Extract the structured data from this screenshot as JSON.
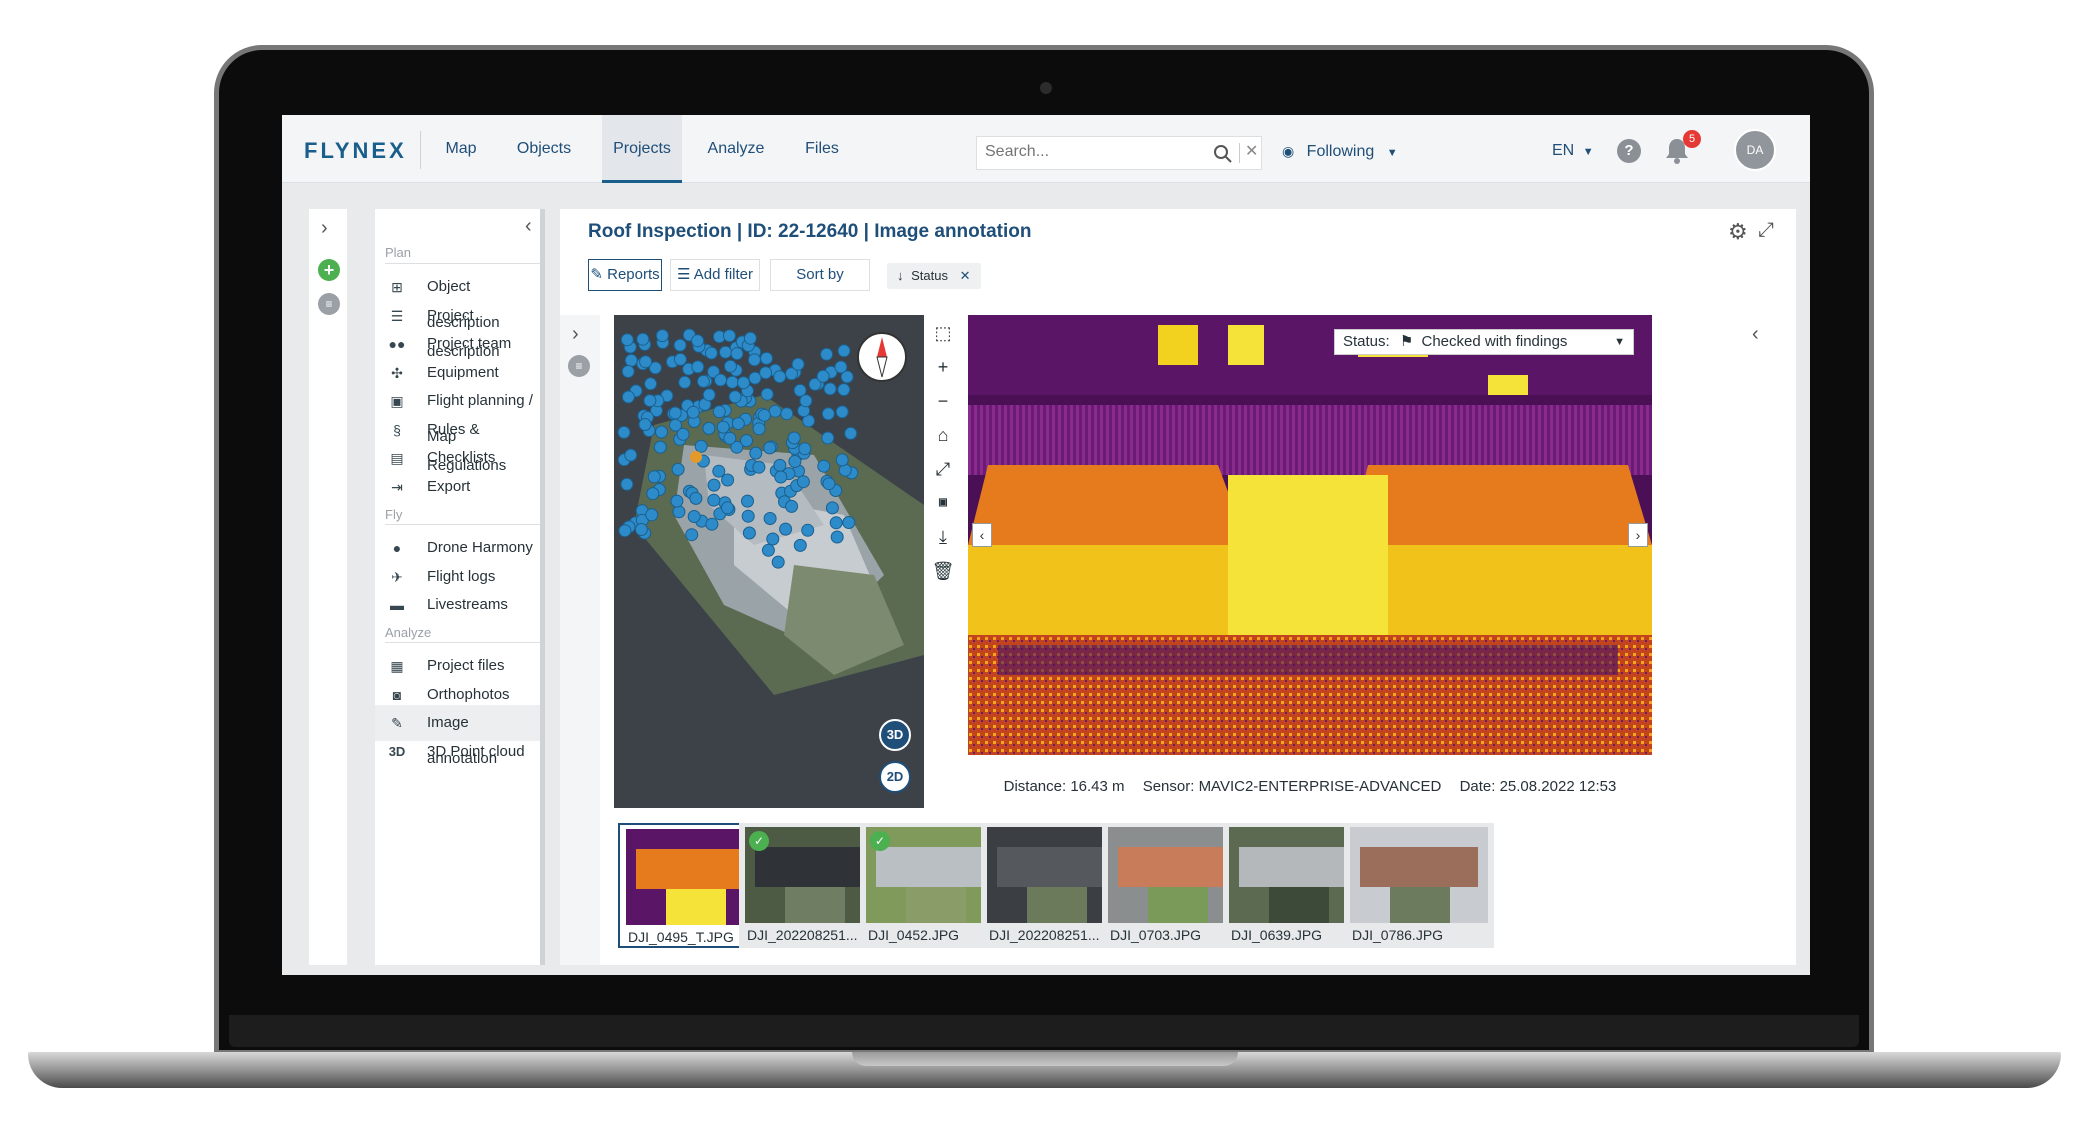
{
  "app": {
    "logo": "FLYNEX"
  },
  "nav": [
    {
      "label": "Map"
    },
    {
      "label": "Objects"
    },
    {
      "label": "Projects"
    },
    {
      "label": "Analyze"
    },
    {
      "label": "Files"
    }
  ],
  "search": {
    "placeholder": "Search..."
  },
  "header": {
    "following": "Following",
    "language": "EN",
    "help": "?",
    "notifications": "5",
    "avatar": "DA"
  },
  "sidebar": {
    "sections": [
      "Plan",
      "Fly",
      "Analyze"
    ],
    "items": [
      {
        "label": "Object description",
        "icon": "object-tree-icon"
      },
      {
        "label": "Project description",
        "icon": "list-icon"
      },
      {
        "label": "Project team",
        "icon": "team-icon"
      },
      {
        "label": "Equipment",
        "icon": "drone-icon"
      },
      {
        "label": "Flight planning / Map",
        "icon": "map-plan-icon"
      },
      {
        "label": "Rules & Regulations",
        "icon": "paragraph-icon"
      },
      {
        "label": "Checklists",
        "icon": "clipboard-icon"
      },
      {
        "label": "Export",
        "icon": "export-icon"
      },
      {
        "label": "Drone Harmony",
        "icon": "circle-icon"
      },
      {
        "label": "Flight logs",
        "icon": "plane-icon"
      },
      {
        "label": "Livestreams",
        "icon": "live-icon"
      },
      {
        "label": "Project files",
        "icon": "files-icon"
      },
      {
        "label": "Orthophotos",
        "icon": "camera-icon"
      },
      {
        "label": "Image annotation",
        "icon": "annotate-icon"
      },
      {
        "label": "3D Point cloud",
        "icon": "3d-icon"
      }
    ],
    "icon_3d": "3D"
  },
  "main": {
    "title": "Roof Inspection | ID: 22-12640 | Image annotation",
    "reports": "Reports",
    "add_filter": "Add filter",
    "sort_by": "Sort by",
    "status_chip": "Status"
  },
  "viewer": {
    "status_label": "Status:",
    "status_value": "Checked with findings",
    "distance": "Distance: 16.43 m",
    "sensor": "Sensor: MAVIC2-ENTERPRISE-ADVANCED",
    "date": "Date: 25.08.2022 12:53",
    "btn_3d": "3D",
    "btn_2d": "2D"
  },
  "thumbnails": [
    {
      "name": "DJI_0495_T.JPG",
      "checked": false
    },
    {
      "name": "DJI_202208251...",
      "checked": true
    },
    {
      "name": "DJI_0452.JPG",
      "checked": true
    },
    {
      "name": "DJI_202208251...",
      "checked": false
    },
    {
      "name": "DJI_0703.JPG",
      "checked": false
    },
    {
      "name": "DJI_0639.JPG",
      "checked": false
    },
    {
      "name": "DJI_0786.JPG",
      "checked": false
    }
  ],
  "colors": {
    "brand": "#1a5f8c",
    "accent_green": "#4caf50",
    "badge_red": "#e53935"
  }
}
